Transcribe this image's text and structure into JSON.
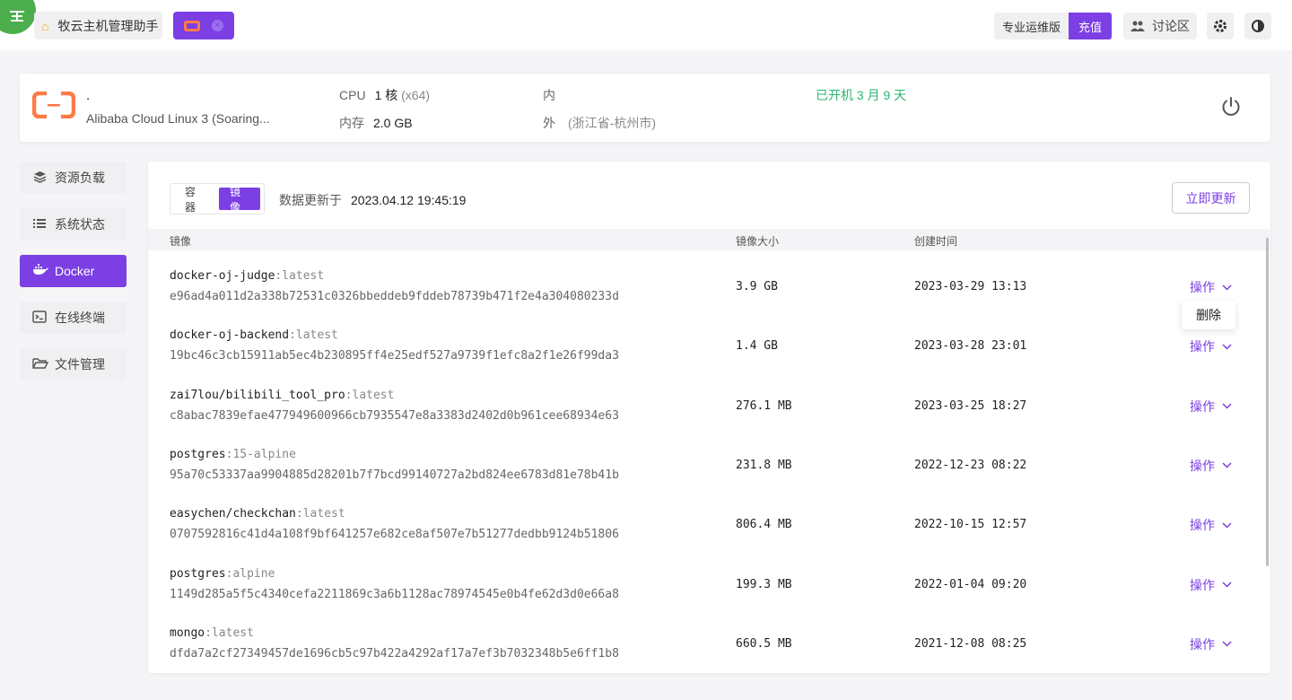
{
  "topbar": {
    "home_tab": "牧云主机管理助手",
    "edition": "专业运维版",
    "recharge": "充值",
    "forum": "讨论区"
  },
  "server": {
    "name": ".",
    "os": "Alibaba Cloud Linux 3 (Soaring...",
    "cpu_label": "CPU",
    "cpu_value": "1 核",
    "cpu_arch": "(x64)",
    "mem_label": "内存",
    "mem_value": "2.0 GB",
    "inner_label": "内",
    "outer_label": "外",
    "outer_value": "(浙江省-杭州市)",
    "uptime": "已开机 3 月 9 天"
  },
  "sidebar": {
    "items": [
      {
        "label": "资源负载",
        "icon": "layers-icon"
      },
      {
        "label": "系统状态",
        "icon": "list-icon"
      },
      {
        "label": "Docker",
        "icon": "docker-icon"
      },
      {
        "label": "在线终端",
        "icon": "terminal-icon"
      },
      {
        "label": "文件管理",
        "icon": "folder-icon"
      }
    ],
    "active": 2
  },
  "panel": {
    "tabs": [
      "容器",
      "镜像"
    ],
    "active_tab": 1,
    "updated_label": "数据更新于",
    "updated_time": "2023.04.12 19:45:19",
    "refresh_label": "立即更新",
    "columns": [
      "镜像",
      "镜像大小",
      "创建时间"
    ],
    "op_label": "操作",
    "popup_label": "删除",
    "rows": [
      {
        "repo": "docker-oj-judge",
        "tag": "latest",
        "id": "e96ad4a011d2a338b72531c0326bbeddeb9fddeb78739b471f2e4a304080233d",
        "size": "3.9 GB",
        "created": "2023-03-29 13:13"
      },
      {
        "repo": "docker-oj-backend",
        "tag": "latest",
        "id": "19bc46c3cb15911ab5ec4b230895ff4e25edf527a9739f1efc8a2f1e26f99da3",
        "size": "1.4 GB",
        "created": "2023-03-28 23:01"
      },
      {
        "repo": "zai7lou/bilibili_tool_pro",
        "tag": "latest",
        "id": "c8abac7839efae477949600966cb7935547e8a3383d2402d0b961cee68934e63",
        "size": "276.1 MB",
        "created": "2023-03-25 18:27"
      },
      {
        "repo": "postgres",
        "tag": "15-alpine",
        "id": "95a70c53337aa9904885d28201b7f7bcd99140727a2bd824ee6783d81e78b41b",
        "size": "231.8 MB",
        "created": "2022-12-23 08:22"
      },
      {
        "repo": "easychen/checkchan",
        "tag": "latest",
        "id": "0707592816c41d4a108f9bf641257e682ce8af507e7b51277dedbb9124b51806",
        "size": "806.4 MB",
        "created": "2022-10-15 12:57"
      },
      {
        "repo": "postgres",
        "tag": "alpine",
        "id": "1149d285a5f5c4340cefa2211869c3a6b1128ac78974545e0b4fe62d3d0e66a8",
        "size": "199.3 MB",
        "created": "2022-01-04 09:20"
      },
      {
        "repo": "mongo",
        "tag": "latest",
        "id": "dfda7a2cf27349457de1696cb5c97b422a4292af17a7ef3b7032348b5e6ff1b8",
        "size": "660.5 MB",
        "created": "2021-12-08 08:25"
      }
    ]
  },
  "colors": {
    "accent": "#7b3fe4",
    "success": "#2bb673",
    "logo_orange": "#ff7a45"
  }
}
